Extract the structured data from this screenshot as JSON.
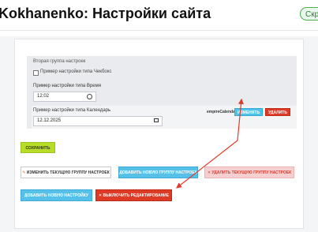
{
  "header": {
    "title": "Kokhanenko: Настройки сайта",
    "right_pill": "Скрипты"
  },
  "settings_group": {
    "title": "Вторая группа настроек",
    "checkbox": {
      "label": "Пример настройки типа Чекбокс",
      "checked": false
    },
    "time": {
      "label": "Пример настройки типа Время",
      "value": "12:02",
      "icon": "clock-icon"
    },
    "calendar": {
      "label": "Пример настройки типа Календарь",
      "value": "12.12.2025",
      "icon": "calendar-icon"
    },
    "code": "empireCalendar",
    "edit_label": "ИЗМЕНИТЬ",
    "delete_label": "УДАЛИТЬ"
  },
  "actions": {
    "save_label": "СОХРАНИТЬ",
    "edit_group_icon": "pencil-icon",
    "edit_group_label": "ИЗМЕНИТЬ ТЕКУЩУЮ ГРУППУ НАСТРОЕК",
    "add_group_label": "ДОБАВИТЬ НОВУЮ ГРУППУ НАСТРОЕК",
    "delete_group_icon": "x-icon",
    "delete_group_label": "УДАЛИТЬ ТЕКУЩУЮ ГРУППУ НАСТРОЕК",
    "add_setting_label": "ДОБАВИТЬ НОВУЮ НАСТРОЙКУ",
    "disable_edit_icon": "x-icon",
    "disable_edit_label": "ВЫКЛЮЧИТЬ РЕДАКТИРОВАНИЕ"
  },
  "colors": {
    "annotation_arrow": "#e03a2b",
    "accent_blue": "#55c1e9",
    "danger_red": "#de3b26",
    "save_green": "#b7dd28"
  }
}
